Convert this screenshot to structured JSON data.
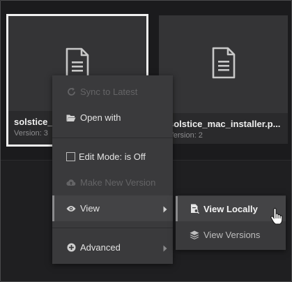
{
  "files": [
    {
      "name": "solstice_",
      "version_label": "Version:",
      "version_value": "3",
      "icon": "document-icon",
      "selected": true
    },
    {
      "name": "solstice_mac_installer.p...",
      "version_label": "Version:",
      "version_value": "2",
      "icon": "document-icon",
      "selected": false
    }
  ],
  "context_menu": {
    "sync": {
      "label": "Sync to Latest",
      "icon": "sync-icon",
      "disabled": true
    },
    "open_with": {
      "label": "Open with",
      "icon": "folder-open-icon"
    },
    "edit_mode": {
      "label": "Edit Mode: is Off",
      "checked": false
    },
    "make_version": {
      "label": "Make New Version",
      "icon": "cloud-upload-icon",
      "disabled": true
    },
    "view": {
      "label": "View",
      "icon": "eye-icon",
      "has_submenu": true
    },
    "advanced": {
      "label": "Advanced",
      "icon": "plus-circle-icon",
      "has_submenu": true
    }
  },
  "submenu": {
    "view_locally": {
      "label": "View Locally",
      "icon": "file-view-icon"
    },
    "view_versions": {
      "label": "View Versions",
      "icon": "layers-icon"
    }
  },
  "colors": {
    "background": "#1f1f21",
    "card": "#343436",
    "menu": "#3a3a3c",
    "selected_border": "#f2f2f2",
    "disabled_text": "#646466"
  }
}
